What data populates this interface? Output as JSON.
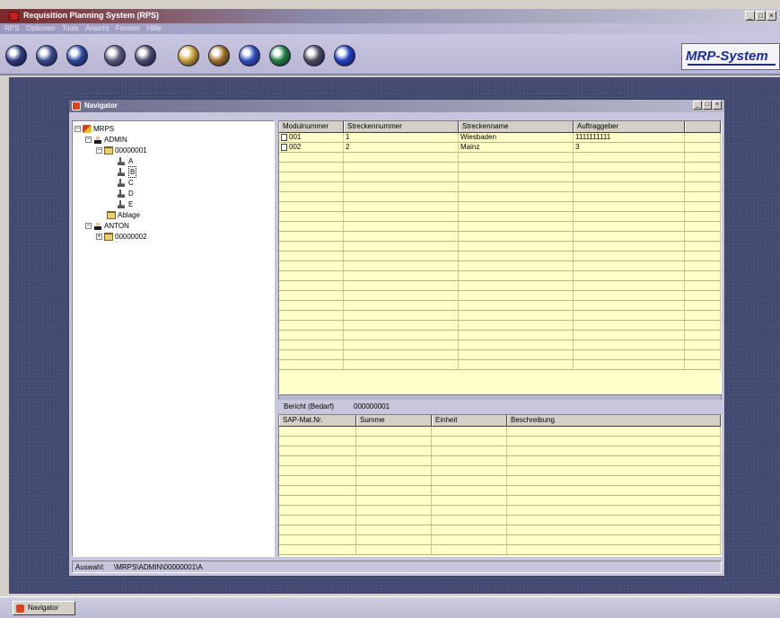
{
  "app": {
    "title": "Requisition Planning System (RPS)",
    "menu": [
      "RPS",
      "Optionen",
      "Tools",
      "Ansicht",
      "Fenster",
      "Hilfe"
    ],
    "window_buttons": [
      "_",
      "□",
      "×"
    ],
    "logo": "MRP-System"
  },
  "toolbar": {
    "buttons": [
      {
        "icon": "power-icon",
        "color": "#2a3a7a"
      },
      {
        "icon": "power-alt-icon",
        "color": "#3a4a8a"
      },
      {
        "icon": "globe-icon",
        "color": "#2a4a9a"
      },
      {
        "icon": "user-folder-icon",
        "color": "#5a5a7a"
      },
      {
        "icon": "user-group-icon",
        "color": "#4a4a6a"
      },
      {
        "icon": "disc-icon",
        "color": "#c8a030"
      },
      {
        "icon": "cd-icon",
        "color": "#a07020"
      },
      {
        "icon": "target-icon",
        "color": "#3050c0"
      },
      {
        "icon": "earth-icon",
        "color": "#208040"
      },
      {
        "icon": "book-icon",
        "color": "#4a4a5a"
      },
      {
        "icon": "info-icon",
        "color": "#2040c0"
      }
    ]
  },
  "navigator": {
    "title": "Navigator",
    "window_buttons": [
      "_",
      "□",
      "×"
    ],
    "tree": [
      {
        "label": "MRPS",
        "icon": "root-icon",
        "expander": "−"
      },
      {
        "label": "ADMIN",
        "icon": "user-icon",
        "expander": "−"
      },
      {
        "label": "00000001",
        "icon": "folder-icon",
        "expander": "−"
      },
      {
        "label": "A",
        "icon": "tool-icon",
        "expander": ""
      },
      {
        "label": "B",
        "icon": "tool-icon",
        "expander": ""
      },
      {
        "label": "C",
        "icon": "tool-icon",
        "expander": ""
      },
      {
        "label": "D",
        "icon": "tool-icon",
        "expander": ""
      },
      {
        "label": "E",
        "icon": "tool-icon",
        "expander": ""
      },
      {
        "label": "Ablage",
        "icon": "folder-icon",
        "expander": ""
      },
      {
        "label": "ANTON",
        "icon": "user-icon",
        "expander": "−"
      },
      {
        "label": "00000002",
        "icon": "folder-icon",
        "expander": "+"
      }
    ],
    "grid1": {
      "columns": [
        "Modulnummer",
        "Streckennummer",
        "Streckenname",
        "Auftraggeber",
        ""
      ],
      "rows": [
        [
          "001",
          "1",
          "Wiesbaden",
          "1111111111",
          ""
        ],
        [
          "002",
          "2",
          "Mainz",
          "3",
          ""
        ]
      ]
    },
    "bericht": {
      "label": "Bericht (Bedarf)",
      "value": "000000001"
    },
    "grid2": {
      "columns": [
        "SAP-Mat.Nr.",
        "Summe",
        "Einheit",
        "Beschreibung"
      ],
      "rows": []
    },
    "status": {
      "label": "Auswahl:",
      "value": "\\MRPS\\ADMIN\\00000001\\A"
    }
  },
  "taskbar": {
    "items": [
      "Navigator"
    ]
  }
}
